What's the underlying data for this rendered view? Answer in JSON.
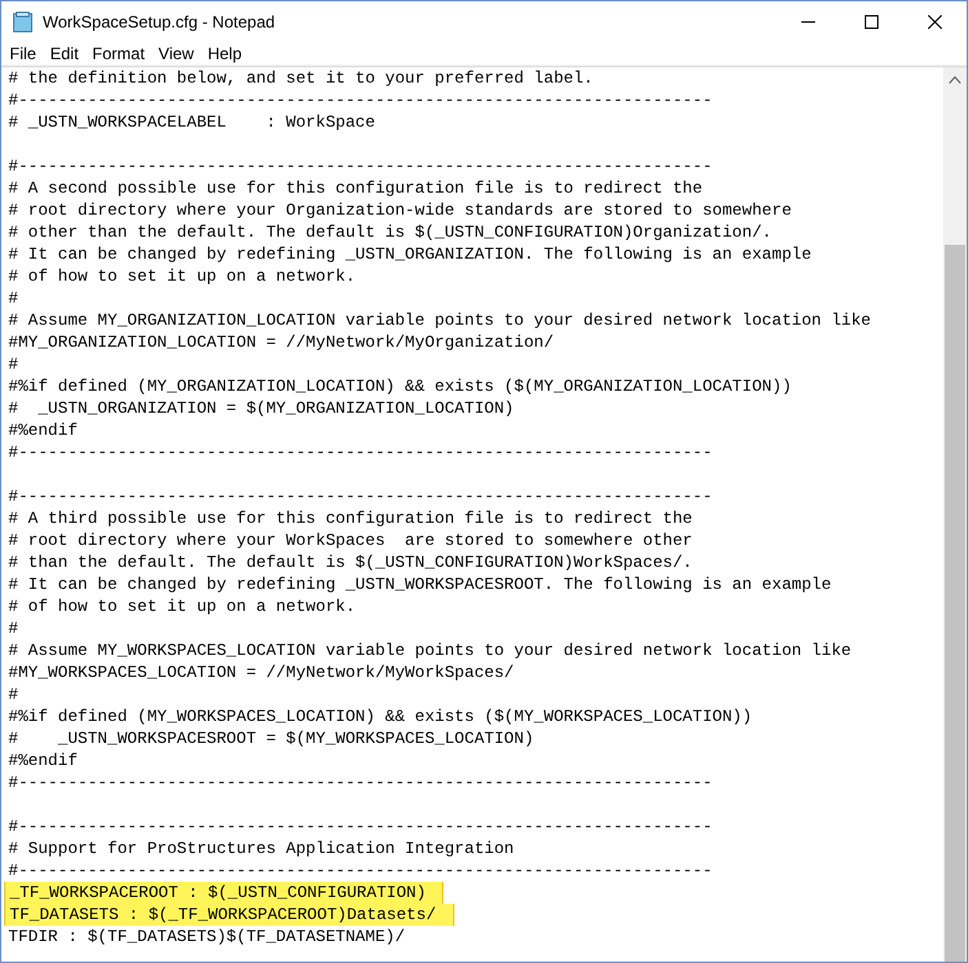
{
  "window": {
    "title": "WorkSpaceSetup.cfg - Notepad"
  },
  "menu": [
    "File",
    "Edit",
    "Format",
    "View",
    "Help"
  ],
  "blocks": [
    {
      "lines": [
        {
          "text": "# the definition below, and set it to your preferred label.",
          "highlighted": false
        },
        {
          "text": "#----------------------------------------------------------------------",
          "highlighted": false
        },
        {
          "text": "# _USTN_WORKSPACELABEL    : WorkSpace",
          "highlighted": false
        }
      ]
    },
    {
      "lines": [
        {
          "text": "#----------------------------------------------------------------------",
          "highlighted": false
        },
        {
          "text": "# A second possible use for this configuration file is to redirect the",
          "highlighted": false
        },
        {
          "text": "# root directory where your Organization-wide standards are stored to somewhere",
          "highlighted": false
        },
        {
          "text": "# other than the default. The default is $(_USTN_CONFIGURATION)Organization/.",
          "highlighted": false
        },
        {
          "text": "# It can be changed by redefining _USTN_ORGANIZATION. The following is an example",
          "highlighted": false
        },
        {
          "text": "# of how to set it up on a network.",
          "highlighted": false
        },
        {
          "text": "#",
          "highlighted": false
        },
        {
          "text": "# Assume MY_ORGANIZATION_LOCATION variable points to your desired network location like",
          "highlighted": false
        },
        {
          "text": "#MY_ORGANIZATION_LOCATION = //MyNetwork/MyOrganization/",
          "highlighted": false
        },
        {
          "text": "#",
          "highlighted": false
        },
        {
          "text": "#%if defined (MY_ORGANIZATION_LOCATION) && exists ($(MY_ORGANIZATION_LOCATION))",
          "highlighted": false
        },
        {
          "text": "#  _USTN_ORGANIZATION = $(MY_ORGANIZATION_LOCATION)",
          "highlighted": false
        },
        {
          "text": "#%endif",
          "highlighted": false
        },
        {
          "text": "#----------------------------------------------------------------------",
          "highlighted": false
        }
      ]
    },
    {
      "lines": [
        {
          "text": "#----------------------------------------------------------------------",
          "highlighted": false
        },
        {
          "text": "# A third possible use for this configuration file is to redirect the",
          "highlighted": false
        },
        {
          "text": "# root directory where your WorkSpaces  are stored to somewhere other",
          "highlighted": false
        },
        {
          "text": "# than the default. The default is $(_USTN_CONFIGURATION)WorkSpaces/.",
          "highlighted": false
        },
        {
          "text": "# It can be changed by redefining _USTN_WORKSPACESROOT. The following is an example",
          "highlighted": false
        },
        {
          "text": "# of how to set it up on a network.",
          "highlighted": false
        },
        {
          "text": "#",
          "highlighted": false
        },
        {
          "text": "# Assume MY_WORKSPACES_LOCATION variable points to your desired network location like",
          "highlighted": false
        },
        {
          "text": "#MY_WORKSPACES_LOCATION = //MyNetwork/MyWorkSpaces/",
          "highlighted": false
        },
        {
          "text": "#",
          "highlighted": false
        },
        {
          "text": "#%if defined (MY_WORKSPACES_LOCATION) && exists ($(MY_WORKSPACES_LOCATION))",
          "highlighted": false
        },
        {
          "text": "#    _USTN_WORKSPACESROOT = $(MY_WORKSPACES_LOCATION)",
          "highlighted": false
        },
        {
          "text": "#%endif",
          "highlighted": false
        },
        {
          "text": "#----------------------------------------------------------------------",
          "highlighted": false
        }
      ]
    },
    {
      "lines": [
        {
          "text": "#----------------------------------------------------------------------",
          "highlighted": false
        },
        {
          "text": "# Support for ProStructures Application Integration",
          "highlighted": false
        },
        {
          "text": "#----------------------------------------------------------------------",
          "highlighted": false
        },
        {
          "text": "_TF_WORKSPACEROOT : $(_USTN_CONFIGURATION)",
          "highlighted": true
        },
        {
          "text": "TF_DATASETS : $(_TF_WORKSPACEROOT)Datasets/",
          "highlighted": true
        },
        {
          "text": "TFDIR : $(TF_DATASETS)$(TF_DATASETNAME)/",
          "highlighted": false
        }
      ]
    }
  ]
}
